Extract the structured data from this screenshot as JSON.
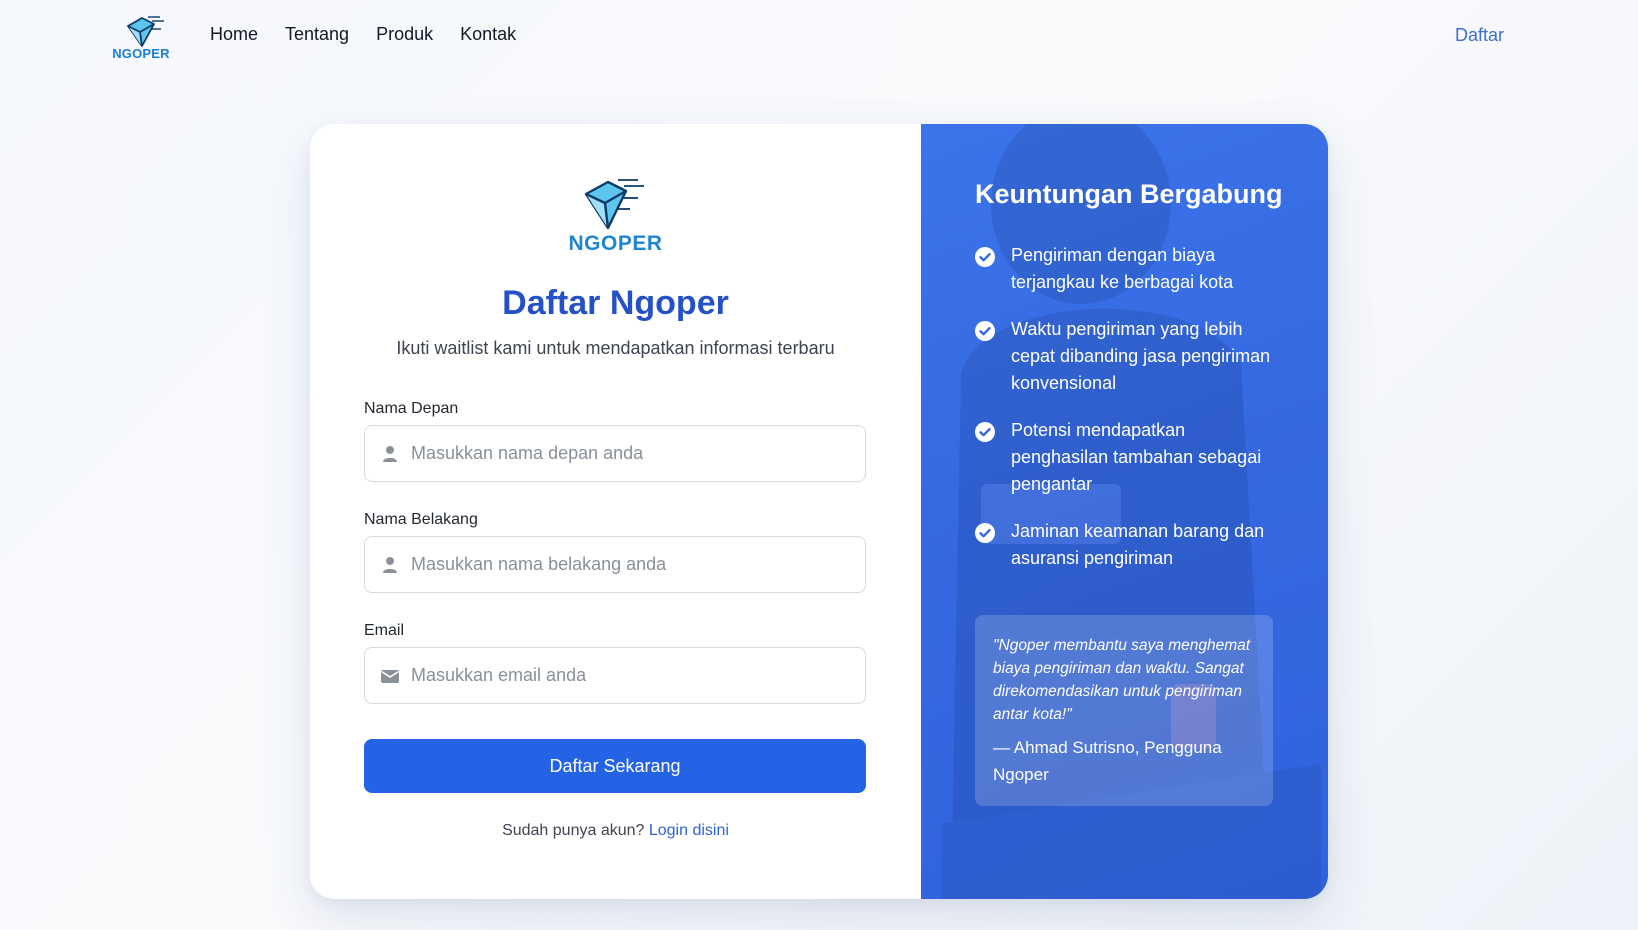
{
  "nav": {
    "logo_text": "NGOPER",
    "links": [
      "Home",
      "Tentang",
      "Produk",
      "Kontak"
    ],
    "cta": "Daftar"
  },
  "form": {
    "logo_text": "NGOPER",
    "title": "Daftar Ngoper",
    "subtitle": "Ikuti waitlist kami untuk mendapatkan informasi terbaru",
    "fields": [
      {
        "label": "Nama Depan",
        "placeholder": "Masukkan nama depan anda",
        "value": "",
        "icon": "user-icon"
      },
      {
        "label": "Nama Belakang",
        "placeholder": "Masukkan nama belakang anda",
        "value": "",
        "icon": "user-icon"
      },
      {
        "label": "Email",
        "placeholder": "Masukkan email anda",
        "value": "",
        "icon": "envelope-icon"
      }
    ],
    "submit_label": "Daftar Sekarang",
    "login_prompt": "Sudah punya akun?",
    "login_link": "Login disini"
  },
  "benefits": {
    "title": "Keuntungan Bergabung",
    "items": [
      "Pengiriman dengan biaya terjangkau ke berbagai kota",
      "Waktu pengiriman yang lebih cepat dibanding jasa pengiriman konvensional",
      "Potensi mendapatkan penghasilan tambahan sebagai pengantar",
      "Jaminan keamanan barang dan asuransi pengiriman"
    ],
    "testimonial": {
      "quote": "\"Ngoper membantu saya menghemat biaya pengiriman dan waktu. Sangat direkomendasikan untuk pengiriman antar kota!\"",
      "author": "— Ahmad Sutrisno, Pengguna Ngoper"
    }
  },
  "colors": {
    "brand_primary": "#2563e6",
    "title_blue": "#2551c8",
    "panel_blue": "#3568e0",
    "logo_blue": "#1f86cf",
    "link_blue": "#2b63d1"
  }
}
